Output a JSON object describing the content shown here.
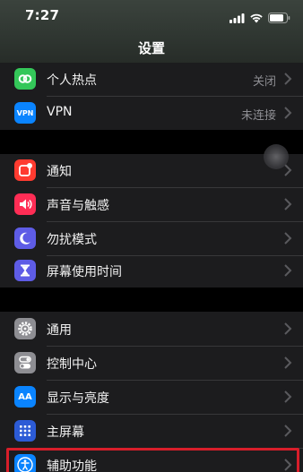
{
  "status_bar": {
    "time": "7:27"
  },
  "nav": {
    "title": "设置"
  },
  "groups": {
    "network": [
      {
        "name": "personal-hotspot",
        "label": "个人热点",
        "value": "关闭",
        "icon": "link-icon",
        "color": "#34c759"
      },
      {
        "name": "vpn",
        "label": "VPN",
        "value": "未连接",
        "icon": "vpn-icon",
        "icon_text": "VPN",
        "color": "#0a84ff"
      }
    ],
    "notifications": [
      {
        "name": "notifications",
        "label": "通知",
        "icon": "notification-icon",
        "color": "#ff3b30"
      },
      {
        "name": "sounds-haptics",
        "label": "声音与触感",
        "icon": "speaker-icon",
        "color": "#ff2d55"
      },
      {
        "name": "do-not-disturb",
        "label": "勿扰模式",
        "icon": "moon-icon",
        "color": "#5e5ce6"
      },
      {
        "name": "screen-time",
        "label": "屏幕使用时间",
        "icon": "hourglass-icon",
        "color": "#5e5ce6"
      }
    ],
    "general": [
      {
        "name": "general",
        "label": "通用",
        "icon": "gear-icon",
        "color": "#8e8e93"
      },
      {
        "name": "control-center",
        "label": "控制中心",
        "icon": "toggle-icon",
        "color": "#8e8e93"
      },
      {
        "name": "display-brightness",
        "label": "显示与亮度",
        "icon": "text-size-icon",
        "icon_text": "AA",
        "color": "#0a84ff"
      },
      {
        "name": "home-screen",
        "label": "主屏幕",
        "icon": "grid-icon",
        "color": "#2c5bd6"
      },
      {
        "name": "accessibility",
        "label": "辅助功能",
        "icon": "accessibility-icon",
        "color": "#0a84ff"
      }
    ]
  }
}
